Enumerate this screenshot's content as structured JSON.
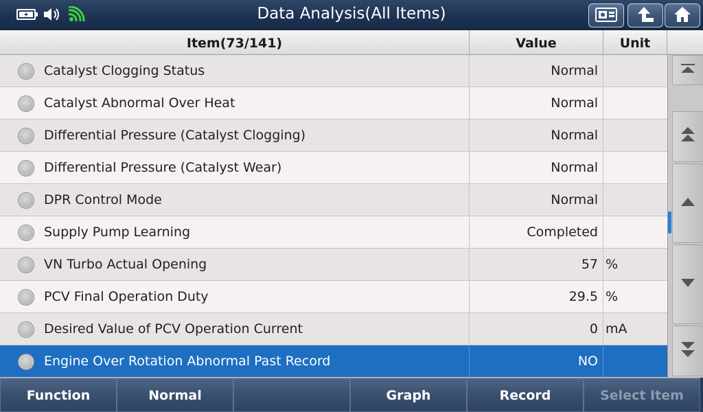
{
  "title": "Data Analysis(All Items)",
  "status_icons": [
    "battery-icon",
    "speaker-icon",
    "wifi-icon"
  ],
  "toolbar": {
    "buttons": [
      "screenshot-icon",
      "back-arrow-icon",
      "home-icon"
    ]
  },
  "table": {
    "headers": {
      "item": "Item(73/141)",
      "value": "Value",
      "unit": "Unit"
    },
    "rows": [
      {
        "item": "Catalyst Clogging Status",
        "value": "Normal",
        "unit": ""
      },
      {
        "item": "Catalyst Abnormal Over Heat",
        "value": "Normal",
        "unit": ""
      },
      {
        "item": "Differential Pressure (Catalyst Clogging)",
        "value": "Normal",
        "unit": ""
      },
      {
        "item": "Differential Pressure (Catalyst Wear)",
        "value": "Normal",
        "unit": ""
      },
      {
        "item": "DPR Control Mode",
        "value": "Normal",
        "unit": ""
      },
      {
        "item": "Supply Pump Learning",
        "value": "Completed",
        "unit": ""
      },
      {
        "item": "VN Turbo Actual Opening",
        "value": "57",
        "unit": "%"
      },
      {
        "item": "PCV Final Operation Duty",
        "value": "29.5",
        "unit": "%"
      },
      {
        "item": "Desired Value of PCV Operation Current",
        "value": "0",
        "unit": "mA"
      },
      {
        "item": "Engine Over Rotation Abnormal Past Record",
        "value": "NO",
        "unit": ""
      }
    ],
    "selected_index": 9
  },
  "scrollbar": {
    "buttons": [
      "scroll-top-icon",
      "page-up-icon",
      "line-up-icon",
      "line-down-icon",
      "page-down-icon",
      "scroll-bottom-icon"
    ],
    "position_fraction": 0.52
  },
  "bottom_bar": {
    "buttons": [
      {
        "label": "Function",
        "enabled": true
      },
      {
        "label": "Normal",
        "enabled": true
      },
      {
        "label": "",
        "enabled": true
      },
      {
        "label": "Graph",
        "enabled": true
      },
      {
        "label": "Record",
        "enabled": true
      },
      {
        "label": "Select Item",
        "enabled": false
      }
    ]
  },
  "colors": {
    "selected_row": "#1e6fc1",
    "titlebar": "#1e3354",
    "scroll_thumb": "#2a7fd4"
  }
}
